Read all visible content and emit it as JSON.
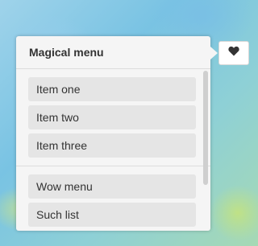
{
  "menu": {
    "title": "Magical menu",
    "groups": [
      {
        "items": [
          "Item one",
          "Item two",
          "Item three"
        ]
      },
      {
        "items": [
          "Wow menu",
          "Such list"
        ]
      }
    ]
  },
  "toggle": {
    "icon": "heart-icon"
  }
}
